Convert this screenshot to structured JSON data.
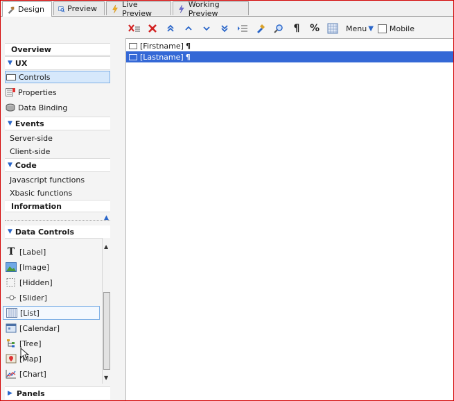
{
  "tabs": [
    {
      "label": "Design",
      "icon": "design-icon",
      "active": true
    },
    {
      "label": "Preview",
      "icon": "preview-icon",
      "active": false
    },
    {
      "label": "Live Preview",
      "icon": "lightning-icon",
      "active": false
    },
    {
      "label": "Working Preview",
      "icon": "lightning-icon",
      "active": false
    }
  ],
  "toolbar": {
    "percent": "%",
    "pilcrow": "¶",
    "menu_label": "Menu",
    "mobile_label": "Mobile"
  },
  "canvas": {
    "rows": [
      {
        "label": "[Firstname]",
        "mark": "¶",
        "selected": false
      },
      {
        "label": "[Lastname]",
        "mark": "¶",
        "selected": true
      }
    ]
  },
  "nav": {
    "overview": "Overview",
    "ux": "UX",
    "controls": "Controls",
    "properties": "Properties",
    "data_binding": "Data Binding",
    "events": "Events",
    "server_side": "Server-side",
    "client_side": "Client-side",
    "code": "Code",
    "javascript_functions": "Javascript functions",
    "xbasic_functions": "Xbasic functions",
    "information": "Information"
  },
  "data_controls": {
    "title": "Data Controls",
    "items": [
      {
        "label": "[Label]",
        "icon": "label-icon"
      },
      {
        "label": "[Image]",
        "icon": "image-icon"
      },
      {
        "label": "[Hidden]",
        "icon": "hidden-icon"
      },
      {
        "label": "[Slider]",
        "icon": "slider-icon"
      },
      {
        "label": "[List]",
        "icon": "list-icon"
      },
      {
        "label": "[Calendar]",
        "icon": "calendar-icon"
      },
      {
        "label": "[Tree]",
        "icon": "tree-icon"
      },
      {
        "label": "[Map]",
        "icon": "map-icon"
      },
      {
        "label": "[Chart]",
        "icon": "chart-icon"
      }
    ]
  },
  "panels": "Panels",
  "colors": {
    "selection": "#3468d6",
    "accent": "#2a66c9",
    "frame": "#d20000"
  }
}
